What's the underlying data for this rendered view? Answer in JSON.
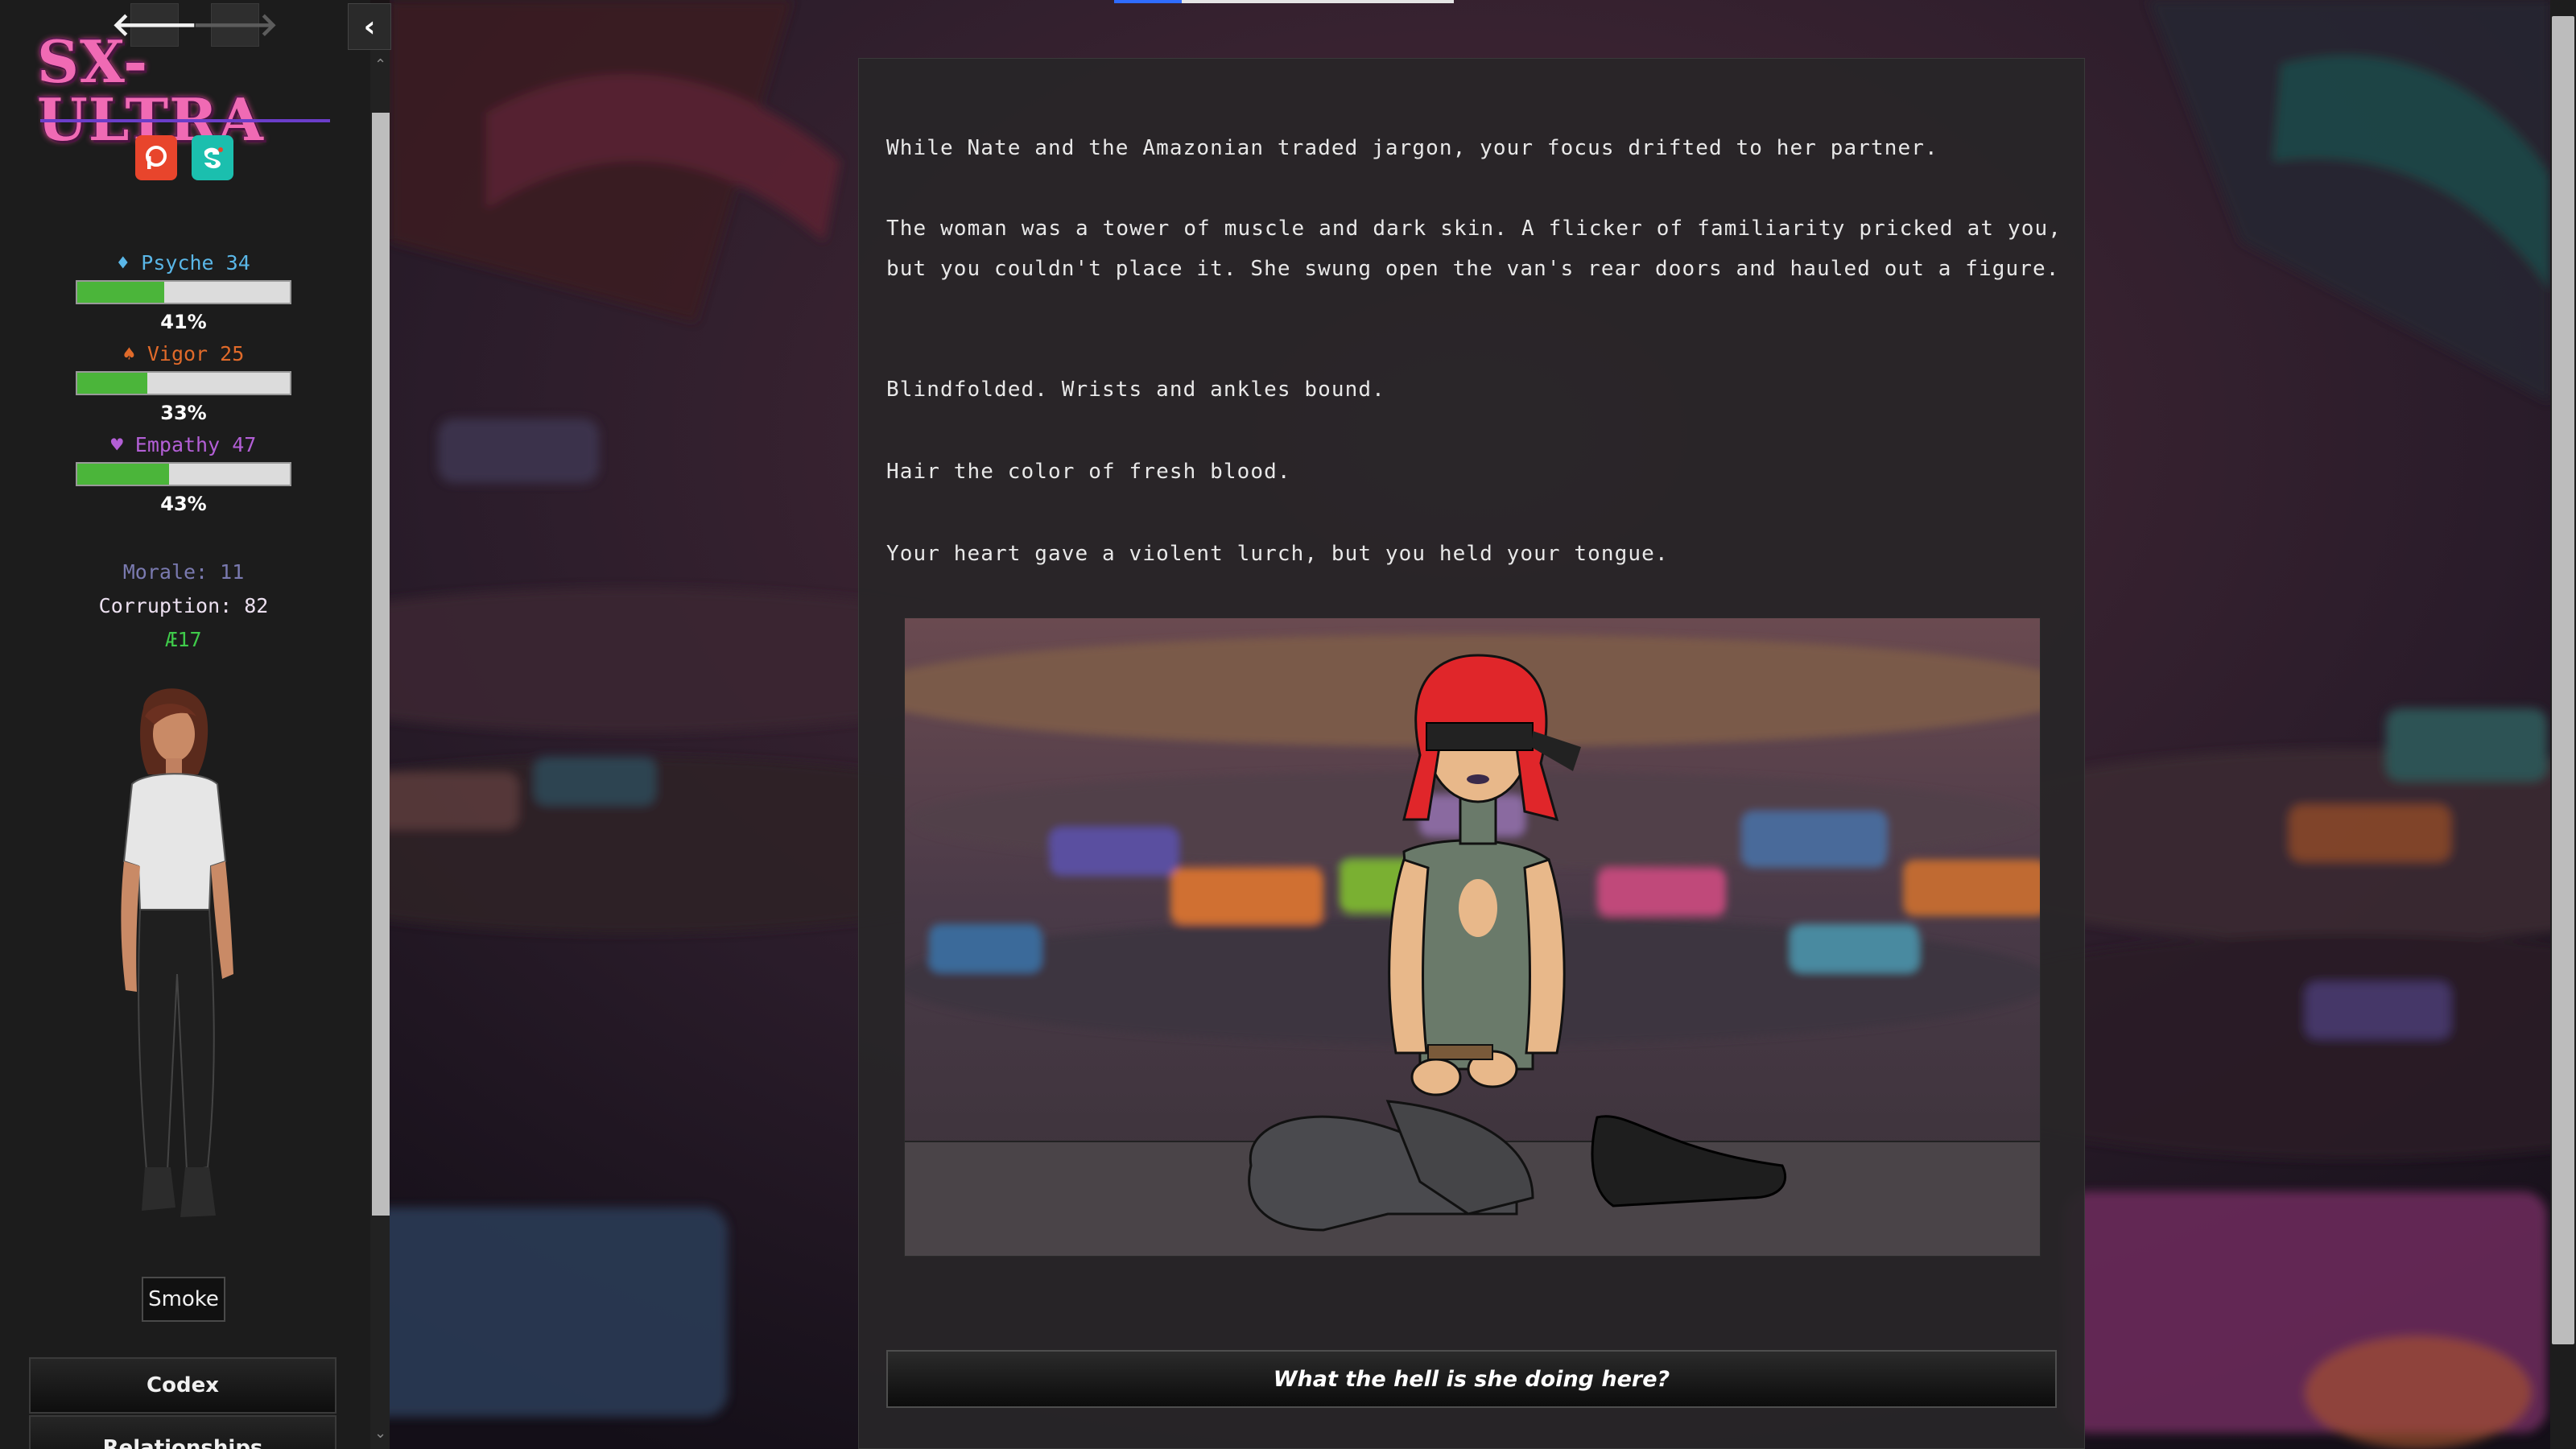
{
  "sidebar": {
    "back_arrow": "🡐",
    "forward_arrow": "🡒",
    "logo": "SX-ULTRA",
    "social": [
      "patreon-icon",
      "subscribestar-icon"
    ],
    "stats": [
      {
        "label": "♦ Psyche 34",
        "percent_text": "41%",
        "fill": 0.41
      },
      {
        "label": "♠ Vigor 25",
        "percent_text": "33%",
        "fill": 0.33
      },
      {
        "label": "♥ Empathy 47",
        "percent_text": "43%",
        "fill": 0.43
      }
    ],
    "morale": "Morale: 11",
    "corruption": "Corruption: 82",
    "currency": "Æ17",
    "smoke_button": "Smoke",
    "menu": {
      "codex": "Codex",
      "relationships": "Relationships"
    },
    "collapse_icon": "‹"
  },
  "passage": {
    "paragraphs": [
      "While Nate and the Amazonian traded jargon, your focus drifted to her partner.",
      "The woman was a tower of muscle and dark skin. A flicker of familiarity pricked at you, but you couldn't place it. She swung open the van's rear doors and hauled out a figure.",
      "Blindfolded. Wrists and ankles bound.",
      "Hair the color of fresh blood.",
      "Your heart gave a violent lurch, but you held your tongue."
    ],
    "choice": "What the hell is she doing here?"
  },
  "progress": {
    "fill": 0.2
  },
  "colors": {
    "psyche": "#5ab7e8",
    "vigor": "#e06a2a",
    "empathy": "#b35fd6",
    "bar_fill": "#4bb53a",
    "currency": "#3fcb4a"
  }
}
